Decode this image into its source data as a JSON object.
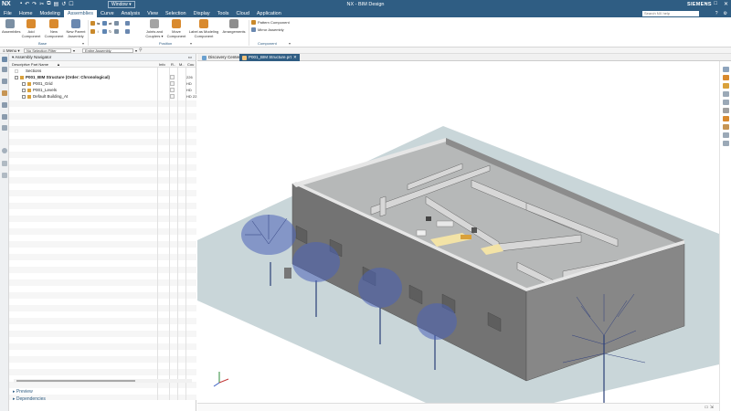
{
  "app": {
    "logo": "NX",
    "window_menu": "Window",
    "title": "NX - BIM Design",
    "brand": "SIEMENS"
  },
  "menus": [
    "File",
    "Home",
    "Modeling",
    "Assemblies",
    "Curve",
    "Analysis",
    "View",
    "Selection",
    "Display",
    "Tools",
    "Cloud",
    "Application"
  ],
  "active_menu": "Assemblies",
  "search_placeholder": "Search NX help",
  "ribbon": {
    "assemblies": "Assemblies",
    "add_component": "Add Component",
    "new_component": "New Component",
    "new_parent_assembly": "New Parent Assembly",
    "joints_couplers": "Joints and Couplers",
    "move_component": "Move Component",
    "label_modeling_component": "Label as Modeling Component",
    "arrangements": "Arrangements",
    "pattern_component": "Pattern Component",
    "mirror_assembly": "Mirror Assembly",
    "groups": {
      "base": "Base",
      "position": "Position",
      "component": "Component"
    }
  },
  "filterbar": {
    "menu": "Menu",
    "selection_filter": "No Selection Filter",
    "scope": "Entire Assembly"
  },
  "navigator": {
    "title": "Assembly Navigator",
    "columns": {
      "name": "Descriptive Part Name",
      "info": "Info",
      "r": "R..",
      "m": "M..",
      "count": "Cou"
    },
    "rows": [
      {
        "name": "Sections",
        "indent": 0,
        "bold": false,
        "count": ""
      },
      {
        "name": "P001_BIM Structure (Order: Chronological)",
        "indent": 0,
        "bold": true,
        "count": "226"
      },
      {
        "name": "P001_Grid",
        "indent": 1,
        "bold": false,
        "count": "HD"
      },
      {
        "name": "P001_Levels",
        "indent": 1,
        "bold": false,
        "count": "HD"
      },
      {
        "name": "Default Building_At",
        "indent": 1,
        "bold": false,
        "count": "HD 221"
      }
    ],
    "preview": "Preview",
    "dependencies": "Dependencies"
  },
  "tabs": {
    "discovery": "Discovery Center",
    "part": "P001_BIM Structure.prt"
  }
}
